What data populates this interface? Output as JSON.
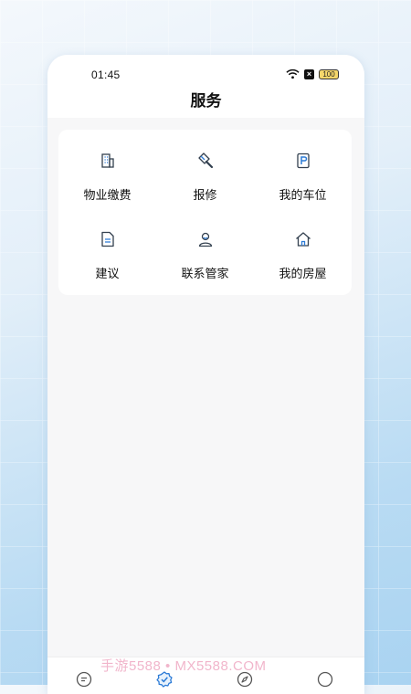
{
  "status_bar": {
    "time": "01:45",
    "battery": "100"
  },
  "header": {
    "title": "服务"
  },
  "services": [
    {
      "label": "物业缴费",
      "icon": "building-icon"
    },
    {
      "label": "报修",
      "icon": "repair-brush-icon"
    },
    {
      "label": "我的车位",
      "icon": "parking-icon"
    },
    {
      "label": "建议",
      "icon": "document-icon"
    },
    {
      "label": "联系管家",
      "icon": "person-icon"
    },
    {
      "label": "我的房屋",
      "icon": "house-icon"
    }
  ],
  "tab_bar": {
    "tabs": [
      {
        "icon": "message-icon",
        "active": false
      },
      {
        "icon": "service-badge-icon",
        "active": true
      },
      {
        "icon": "compass-icon",
        "active": false
      },
      {
        "icon": "circle-profile-icon",
        "active": false
      }
    ]
  },
  "watermark": "手游5588 • MX5588.COM",
  "colors": {
    "accent": "#2c7bd6",
    "icon": "#33404f",
    "card": "#ffffff",
    "page_bg": "#f7f7f8"
  }
}
